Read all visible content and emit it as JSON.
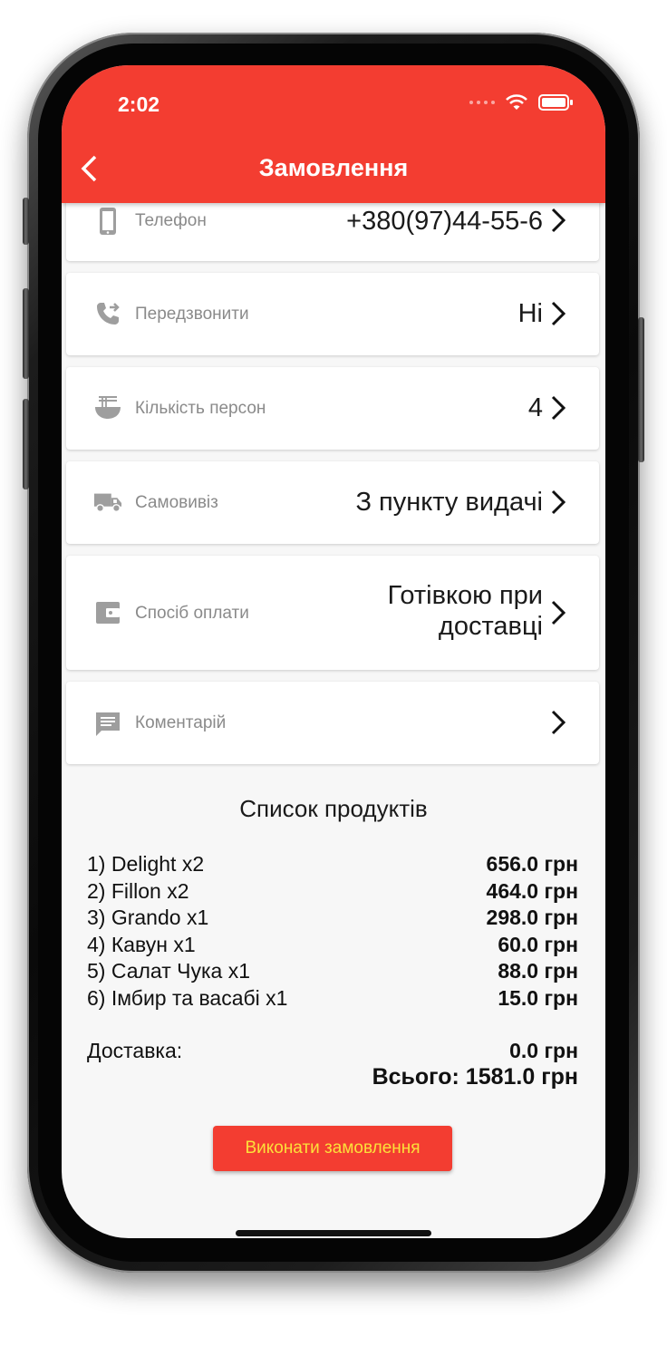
{
  "status_bar": {
    "time": "2:02"
  },
  "header": {
    "title": "Замовлення"
  },
  "fields": [
    {
      "icon": "phone-icon",
      "label": "Телефон",
      "value": "+380(97)44-55-6"
    },
    {
      "icon": "callback-icon",
      "label": "Передзвонити",
      "value": "Ні"
    },
    {
      "icon": "ramen-bowl-icon",
      "label": "Кількість персон",
      "value": "4"
    },
    {
      "icon": "truck-icon",
      "label": "Самовивіз",
      "value": "З пункту видачі"
    },
    {
      "icon": "wallet-icon",
      "label": "Спосіб оплати",
      "value_line1": "Готівкою при",
      "value_line2": "доставці"
    },
    {
      "icon": "comment-icon",
      "label": "Коментарій",
      "value": ""
    }
  ],
  "products": {
    "title": "Список продуктів",
    "items": [
      {
        "name": "1) Delight x2",
        "price": "656.0 грн"
      },
      {
        "name": "2) Fillon x2",
        "price": "464.0 грн"
      },
      {
        "name": "3) Grando x1",
        "price": "298.0 грн"
      },
      {
        "name": "4) Кавун x1",
        "price": "60.0 грн"
      },
      {
        "name": "5) Салат Чука x1",
        "price": "88.0 грн"
      },
      {
        "name": "6) Імбир та васабі x1",
        "price": "15.0 грн"
      }
    ],
    "delivery_label": "Доставка:",
    "delivery_price": "0.0 грн",
    "total": "Всього: 1581.0 грн"
  },
  "submit_label": "Виконати замовлення",
  "colors": {
    "primary": "#f33d31",
    "button_text": "#fce03a",
    "icon_gray": "#9e9e9e"
  }
}
